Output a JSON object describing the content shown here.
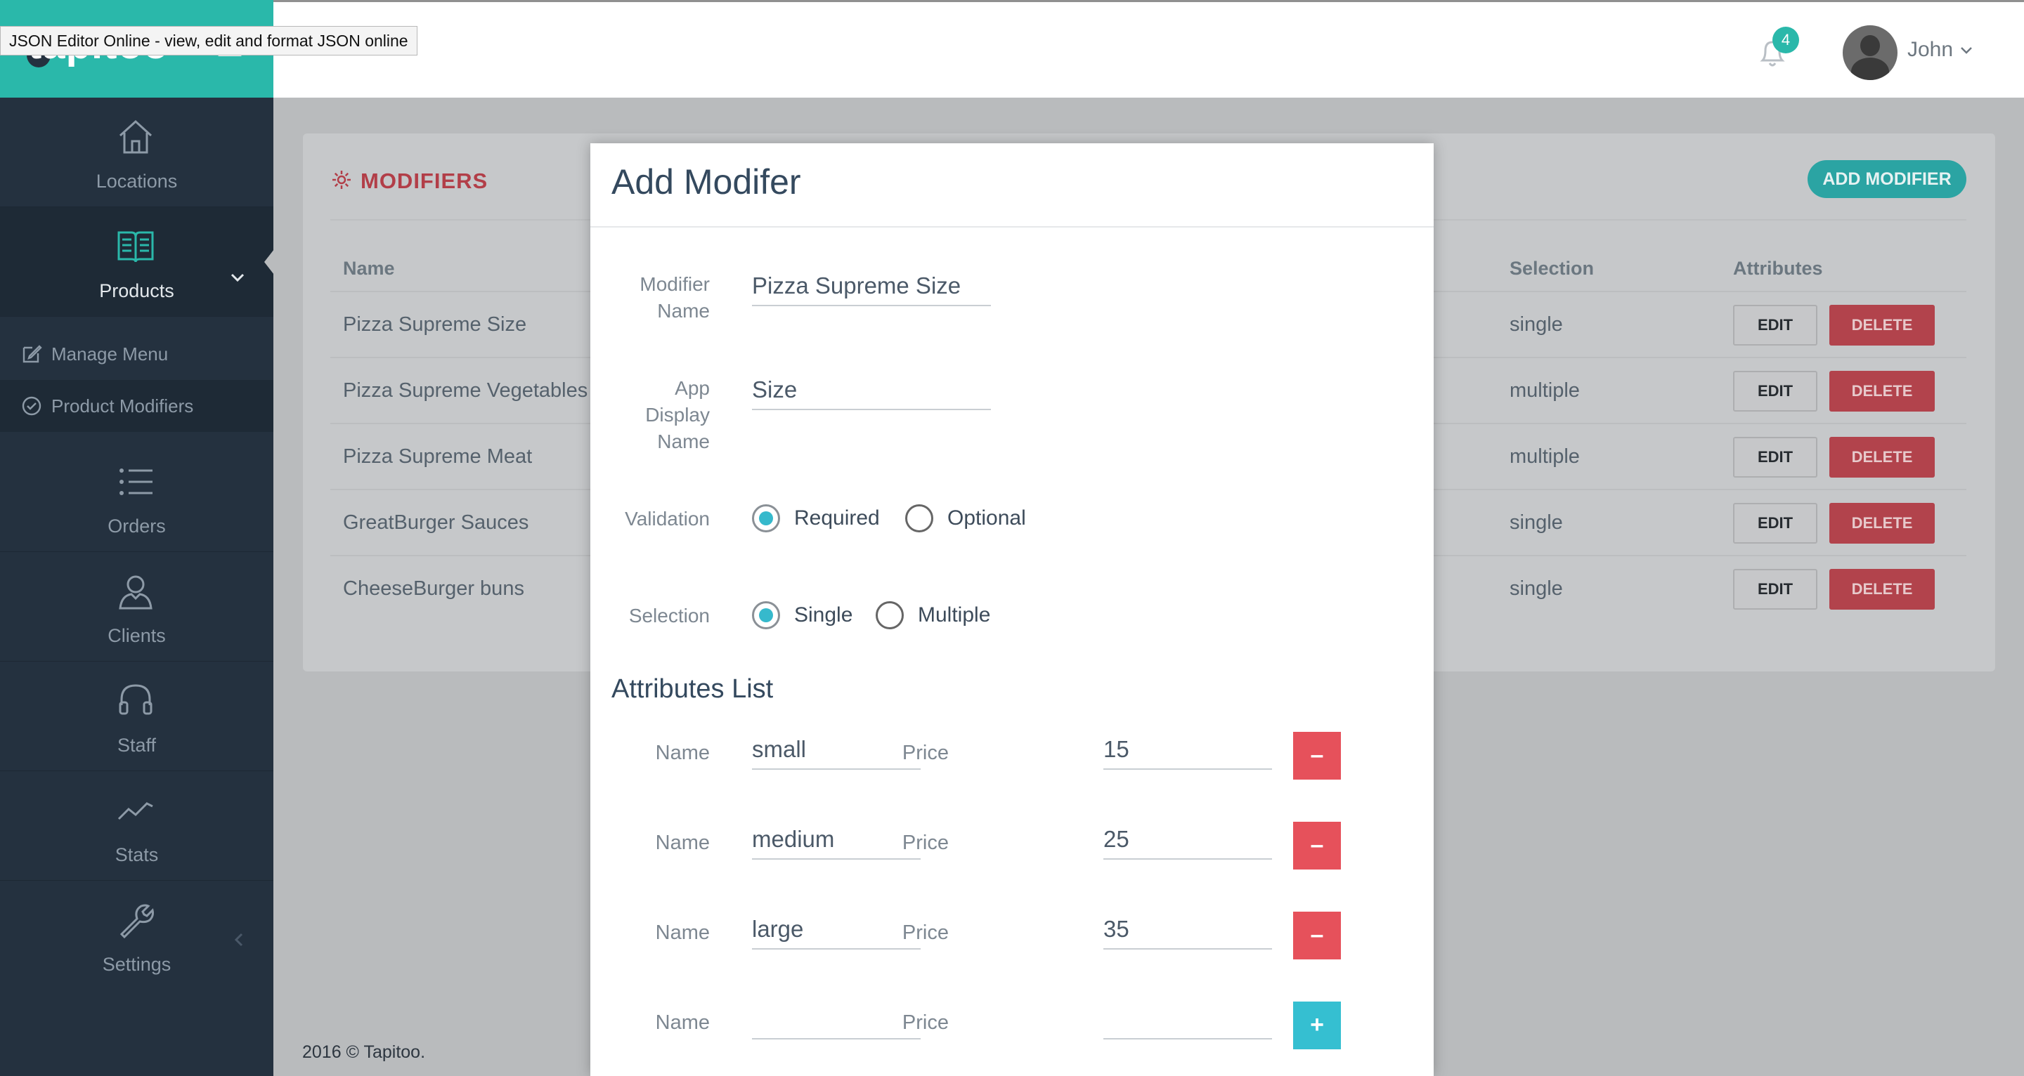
{
  "tooltip": "JSON Editor Online - view, edit and format JSON online",
  "brand": {
    "name": "tapitoo"
  },
  "sidebar": {
    "items": [
      {
        "label": "Locations",
        "icon": "home-icon"
      },
      {
        "label": "Products",
        "icon": "book-icon"
      },
      {
        "label": "Orders",
        "icon": "list-icon"
      },
      {
        "label": "Clients",
        "icon": "user-icon"
      },
      {
        "label": "Staff",
        "icon": "headset-icon"
      },
      {
        "label": "Stats",
        "icon": "chart-line-icon"
      },
      {
        "label": "Settings",
        "icon": "wrench-icon"
      }
    ],
    "submenu": [
      {
        "label": "Manage Menu",
        "icon": "edit-icon"
      },
      {
        "label": "Product Modifiers",
        "icon": "check-circle-icon"
      }
    ]
  },
  "topbar": {
    "notifications": "4",
    "user": "John"
  },
  "page": {
    "title": "MODIFIERS",
    "add_button": "ADD MODIFIER",
    "columns": {
      "name": "Name",
      "selection": "Selection",
      "attributes": "Attributes"
    },
    "rows": [
      {
        "name": "Pizza Supreme Size",
        "selection": "single"
      },
      {
        "name": "Pizza Supreme Vegetables",
        "selection": "multiple"
      },
      {
        "name": "Pizza Supreme Meat",
        "selection": "multiple"
      },
      {
        "name": "GreatBurger Sauces",
        "selection": "single"
      },
      {
        "name": "CheeseBurger buns",
        "selection": "single"
      }
    ],
    "edit_label": "EDIT",
    "delete_label": "DELETE",
    "footer": "2016 © Tapitoo."
  },
  "modal": {
    "title": "Add Modifer",
    "modifier_name_label_1": "Modifier",
    "modifier_name_label_2": "Name",
    "modifier_name_value": "Pizza Supreme Size",
    "app_display_label_1": "App",
    "app_display_label_2": "Display",
    "app_display_label_3": "Name",
    "app_display_value": "Size",
    "validation_label": "Validation",
    "validation_options": [
      "Required",
      "Optional"
    ],
    "validation_selected": "Required",
    "selection_label": "Selection",
    "selection_options": [
      "Single",
      "Multiple"
    ],
    "selection_selected": "Single",
    "attributes_title": "Attributes List",
    "attr_name_label": "Name",
    "attr_price_label": "Price",
    "attributes": [
      {
        "name": "small",
        "price": "15"
      },
      {
        "name": "medium",
        "price": "25"
      },
      {
        "name": "large",
        "price": "35"
      },
      {
        "name": "",
        "price": ""
      }
    ]
  },
  "colors": {
    "brand": "#2ab8aa",
    "sidebar": "#24313f",
    "danger": "#e6515b",
    "accent": "#35bfd1"
  }
}
